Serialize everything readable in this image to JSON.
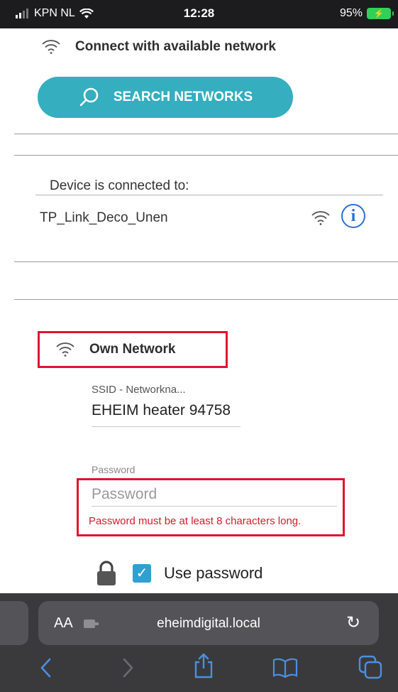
{
  "status_bar": {
    "carrier": "KPN NL",
    "time": "12:28",
    "battery": "95%"
  },
  "connect_section": {
    "title": "Connect with available network",
    "search_button": "SEARCH NETWORKS"
  },
  "device": {
    "label": "Device is connected to:",
    "ssid": "TP_Link_Deco_Unen"
  },
  "own_network": {
    "title": "Own Network",
    "ssid_label": "SSID - Networkna...",
    "ssid_value": "EHEIM heater 94758",
    "password_label": "Password",
    "password_placeholder": "Password",
    "password_error": "Password must be at least 8 characters long.",
    "use_password_label": "Use password",
    "use_password_checked": true
  },
  "browser": {
    "text_size_button": "AA",
    "url": "eheimdigital.local"
  },
  "colors": {
    "accent": "#35aec0",
    "error": "#e0142e",
    "checkbox": "#2fa1d1"
  }
}
